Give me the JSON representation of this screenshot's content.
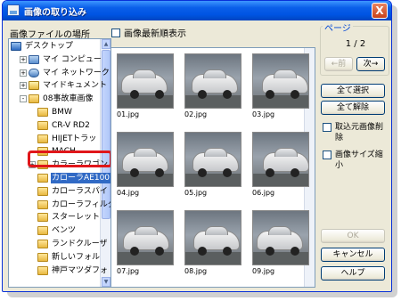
{
  "window": {
    "title": "画像の取り込み",
    "close": "X"
  },
  "left": {
    "label": "画像ファイルの場所",
    "tree": [
      {
        "label": "デスクトップ",
        "icon": "desktop-icon",
        "indent": 0,
        "expander": ""
      },
      {
        "label": "マイ コンピュー",
        "icon": "computer-icon",
        "indent": 1,
        "expander": "+"
      },
      {
        "label": "マイ ネットワーク",
        "icon": "network-icon",
        "indent": 1,
        "expander": "+"
      },
      {
        "label": "マイドキュメント",
        "icon": "documents-icon",
        "indent": 1,
        "expander": "+"
      },
      {
        "label": "08事故車画像",
        "icon": "folder-icon",
        "indent": 1,
        "expander": "-"
      },
      {
        "label": "BMW",
        "icon": "folder-icon",
        "indent": 2,
        "expander": ""
      },
      {
        "label": "CR-V RD2",
        "icon": "folder-icon",
        "indent": 2,
        "expander": ""
      },
      {
        "label": "HIJETトラッ",
        "icon": "folder-icon",
        "indent": 2,
        "expander": ""
      },
      {
        "label": "MACH",
        "icon": "folder-icon",
        "indent": 2,
        "expander": ""
      },
      {
        "label": "カラーラワゴン",
        "icon": "folder-icon",
        "indent": 2,
        "expander": "+"
      },
      {
        "label": "カローラAE100",
        "icon": "folder-icon",
        "indent": 2,
        "expander": "",
        "selected": true
      },
      {
        "label": "カローラスパイ",
        "icon": "folder-icon",
        "indent": 2,
        "expander": ""
      },
      {
        "label": "カローラフィルダー",
        "icon": "folder-icon",
        "indent": 2,
        "expander": ""
      },
      {
        "label": "スターレット",
        "icon": "folder-icon",
        "indent": 2,
        "expander": ""
      },
      {
        "label": "ベンツ",
        "icon": "folder-icon",
        "indent": 2,
        "expander": ""
      },
      {
        "label": "ランドクルーザ",
        "icon": "folder-icon",
        "indent": 2,
        "expander": ""
      },
      {
        "label": "新しいフォル",
        "icon": "folder-icon",
        "indent": 2,
        "expander": ""
      },
      {
        "label": "神戸マツダフォ",
        "icon": "folder-icon",
        "indent": 2,
        "expander": ""
      }
    ]
  },
  "options": {
    "newest_first": "画像最新順表示"
  },
  "grid": {
    "images": [
      "01.jpg",
      "02.jpg",
      "03.jpg",
      "04.jpg",
      "05.jpg",
      "06.jpg",
      "07.jpg",
      "08.jpg",
      "09.jpg"
    ]
  },
  "right": {
    "page_legend": "ページ",
    "page_indicator": "1 / 2",
    "prev": "←前",
    "next": "次→",
    "select_all": "全て選択",
    "deselect_all": "全て解除",
    "delete_source": "取込元画像削除",
    "shrink": "画像サイズ縮小",
    "ok": "OK",
    "cancel": "キャンセル",
    "help": "ヘルプ"
  }
}
